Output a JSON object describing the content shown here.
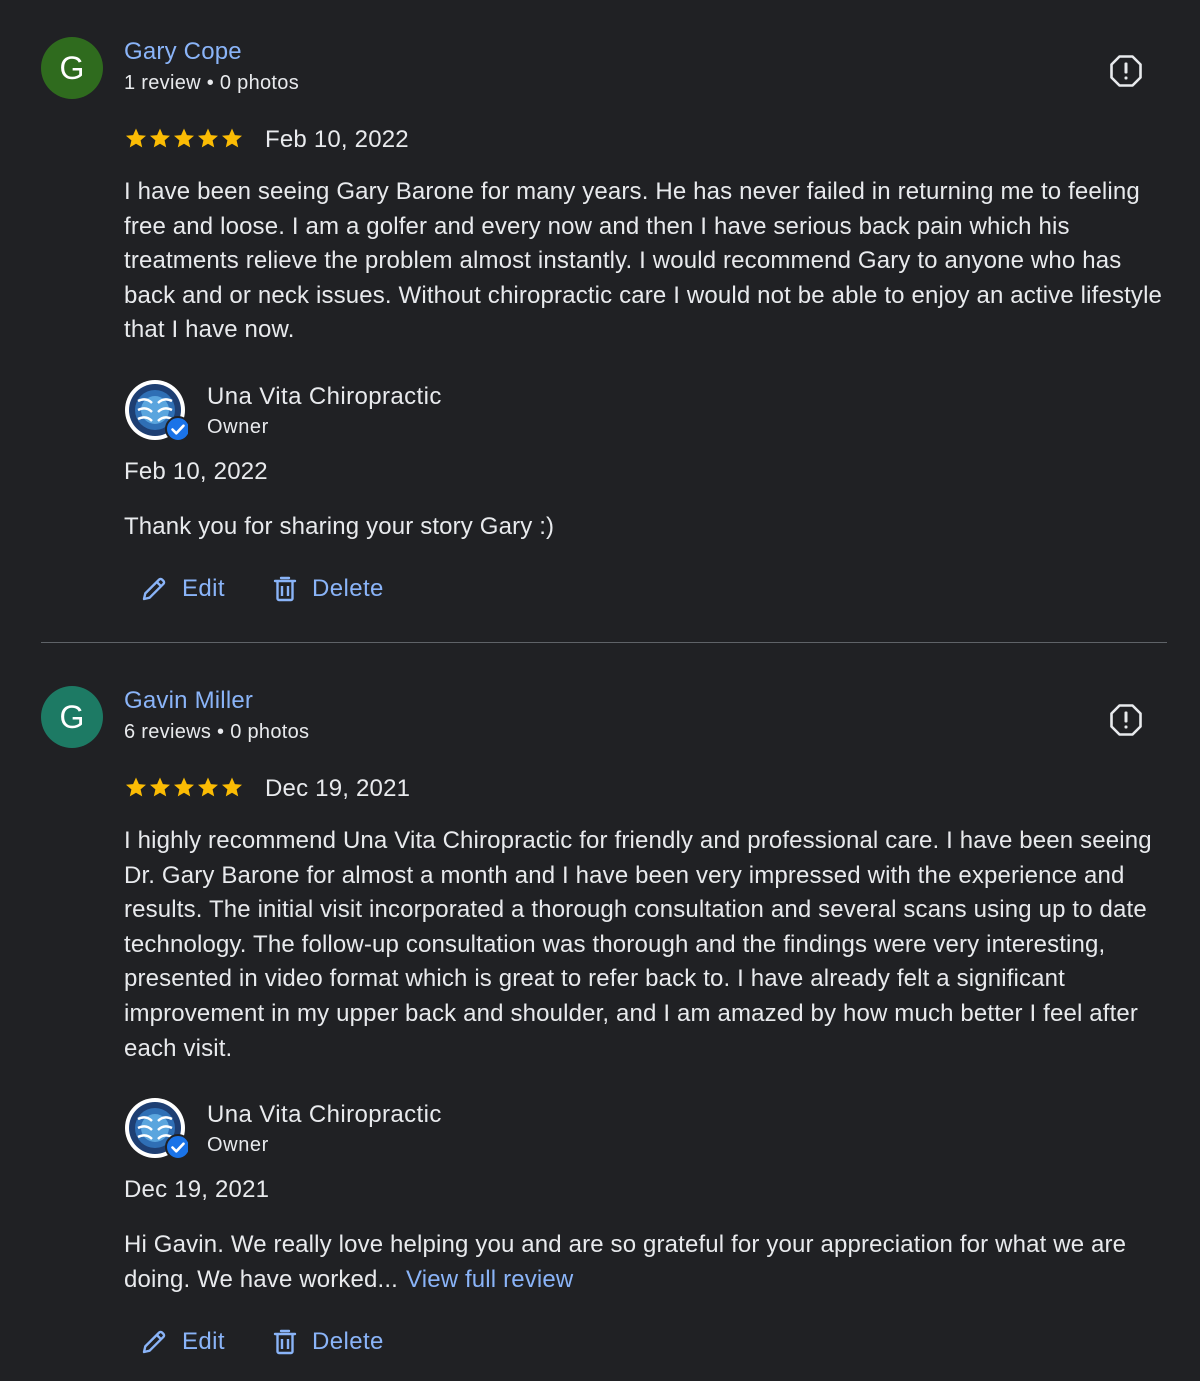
{
  "colors": {
    "background": "#202124",
    "link": "#8ab4f8",
    "text": "#e8eaed",
    "star": "#fbbc04",
    "avatar_review_1": "#2f6b1e",
    "avatar_review_2": "#1d7a64",
    "divider": "#5f6368"
  },
  "reviews": [
    {
      "avatar_letter": "G",
      "author": "Gary Cope",
      "meta": "1 review • 0 photos",
      "rating": 5,
      "date": "Feb 10, 2022",
      "text": "I have been seeing Gary Barone for many years. He has never failed in returning me to feeling free and loose. I am a golfer and every now and then I have serious back pain which his treatments relieve the problem almost instantly. I would recommend Gary to anyone who has back and or neck issues. Without chiropractic care I would not be able to enjoy an active lifestyle that I have now.",
      "owner_reply": {
        "name": "Una Vita Chiropractic",
        "role": "Owner",
        "date": "Feb 10, 2022",
        "text": "Thank you for sharing your story Gary :)"
      },
      "actions": {
        "edit": "Edit",
        "delete": "Delete"
      }
    },
    {
      "avatar_letter": "G",
      "author": "Gavin Miller",
      "meta": "6 reviews • 0 photos",
      "rating": 5,
      "date": "Dec 19, 2021",
      "text": "I highly recommend Una Vita Chiropractic for friendly and professional care. I have been seeing Dr. Gary Barone for almost a month and I have been very impressed with the experience and results. The initial visit incorporated a thorough consultation and several scans using up to date technology. The follow-up consultation was thorough and the findings were very interesting, presented in video format which is great to refer back to. I have already felt a significant improvement in my upper back and shoulder, and I am amazed by how much better I feel after each visit.",
      "owner_reply": {
        "name": "Una Vita Chiropractic",
        "role": "Owner",
        "date": "Dec 19, 2021",
        "text": "Hi Gavin. We really love helping you and are so grateful for your appreciation for what we are doing. We have worked...",
        "view_full": "View full review"
      },
      "actions": {
        "edit": "Edit",
        "delete": "Delete"
      }
    }
  ],
  "icons": {
    "report": "report-flag-icon",
    "star": "star-icon",
    "edit": "pencil-icon",
    "delete": "trash-icon",
    "owner_logo": "una-vita-logo",
    "verified": "verified-badge-icon"
  }
}
